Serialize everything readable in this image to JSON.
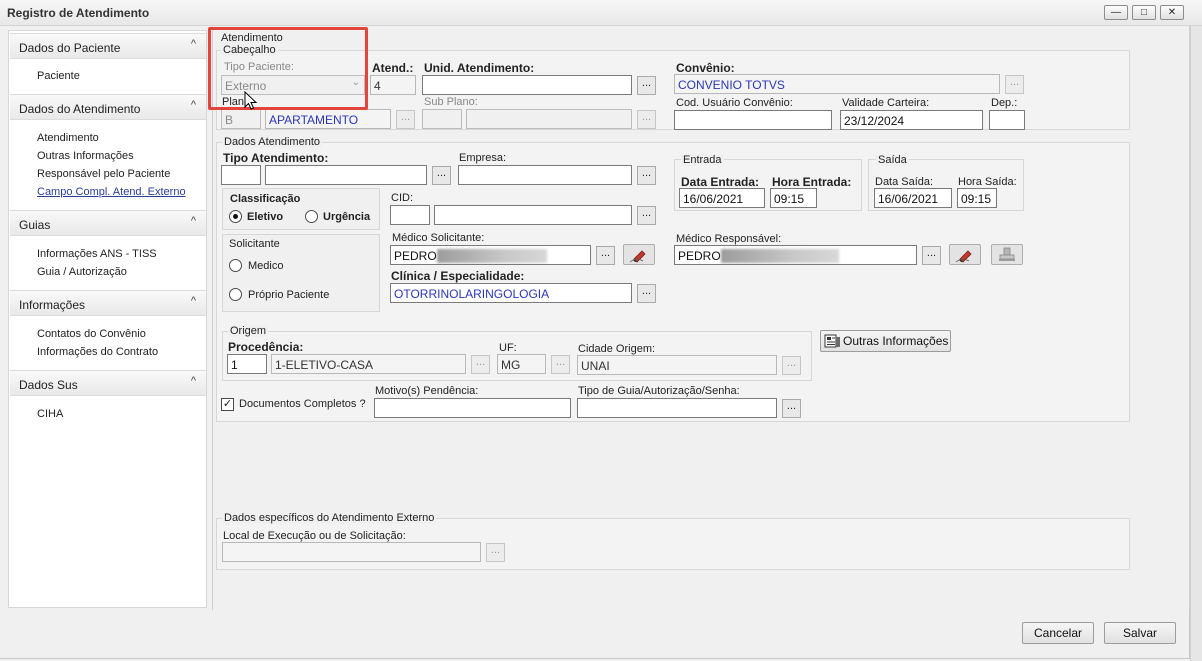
{
  "window": {
    "title": "Registro de Atendimento",
    "minimize_glyph": "—",
    "maximize_glyph": "□",
    "close_glyph": "✕"
  },
  "sidebar": {
    "sections": [
      {
        "title": "Dados do Paciente",
        "items": [
          {
            "label": "Paciente"
          }
        ]
      },
      {
        "title": "Dados do Atendimento",
        "items": [
          {
            "label": "Atendimento"
          },
          {
            "label": "Outras Informações"
          },
          {
            "label": "Responsável pelo Paciente"
          },
          {
            "label": "Campo Compl. Atend. Externo"
          }
        ]
      },
      {
        "title": "Guias",
        "items": [
          {
            "label": "Informações ANS - TISS"
          },
          {
            "label": "Guia / Autorização"
          }
        ]
      },
      {
        "title": "Informações",
        "items": [
          {
            "label": "Contatos do Convênio"
          },
          {
            "label": "Informações do Contrato"
          }
        ]
      },
      {
        "title": "Dados Sus",
        "items": [
          {
            "label": "CIHA"
          }
        ]
      }
    ],
    "chevron_glyph": "^"
  },
  "header": {
    "section_title": "Atendimento",
    "group_title": "Cabeçalho",
    "tipo_paciente_label": "Tipo Paciente:",
    "tipo_paciente_value": "Externo",
    "atend_label": "Atend.:",
    "atend_value": "4",
    "unid_label": "Unid. Atendimento:",
    "unid_value": "",
    "convenio_label": "Convênio:",
    "convenio_value": "CONVENIO TOTVS",
    "plano_label": "Plano:",
    "plano_code": "B",
    "plano_value": "APARTAMENTO",
    "subplano_label": "Sub Plano:",
    "cod_usuario_label": "Cod. Usuário Convênio:",
    "cod_usuario_value": "",
    "validade_label": "Validade Carteira:",
    "validade_value": "23/12/2024",
    "dep_label": "Dep.:",
    "dep_value": ""
  },
  "dados": {
    "group_title": "Dados Atendimento",
    "tipo_atend_label": "Tipo Atendimento:",
    "empresa_label": "Empresa:",
    "entrada_title": "Entrada",
    "data_entrada_label": "Data Entrada:",
    "data_entrada_value": "16/06/2021",
    "hora_entrada_label": "Hora Entrada:",
    "hora_entrada_value": "09:15",
    "saida_title": "Saída",
    "data_saida_label": "Data Saída:",
    "data_saida_value": "16/06/2021",
    "hora_saida_label": "Hora Saída:",
    "hora_saida_value": "09:15",
    "classificacao_title": "Classificação",
    "eletivo_label": "Eletivo",
    "urgencia_label": "Urgência",
    "solicitante_title": "Solicitante",
    "medico_label": "Medico",
    "proprio_label": "Próprio Paciente",
    "cid_label": "CID:",
    "medico_sol_label": "Médico Solicitante:",
    "medico_sol_value": "PEDRO",
    "clinica_label": "Clínica / Especialidade:",
    "clinica_value": "OTORRINOLARINGOLOGIA",
    "medico_resp_label": "Médico Responsável:",
    "medico_resp_value": "PEDRO"
  },
  "origem": {
    "group_title": "Origem",
    "procedencia_label": "Procedência:",
    "procedencia_code": "1",
    "procedencia_value": "1-ELETIVO-CASA",
    "uf_label": "UF:",
    "uf_value": "MG",
    "cidade_label": "Cidade Origem:",
    "cidade_value": "UNAI",
    "outras_button": "Outras Informações"
  },
  "docs": {
    "documentos_label": "Documentos Completos ?",
    "documentos_checked": "✓",
    "motivo_label": "Motivo(s) Pendência:",
    "tipo_guia_label": "Tipo de Guia/Autorização/Senha:"
  },
  "externo": {
    "group_title": "Dados específicos do Atendimento Externo",
    "local_label": "Local de Execução ou de Solicitação:"
  },
  "footer": {
    "cancel_label": "Cancelar",
    "save_label": "Salvar"
  },
  "common": {
    "dots": "..."
  }
}
